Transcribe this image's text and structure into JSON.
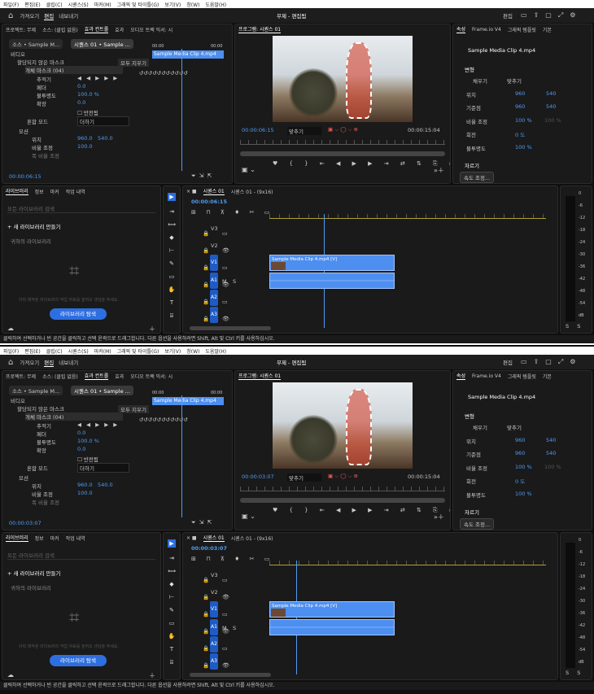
{
  "menu": [
    "파일(F)",
    "편집(E)",
    "클립(C)",
    "시퀀스(S)",
    "마커(M)",
    "그래픽 및 타이틀(G)",
    "보기(V)",
    "창(W)",
    "도움말(H)"
  ],
  "header": {
    "tabs": [
      "가져오기",
      "편집",
      "내보내기"
    ],
    "title": "무제 - 편집됨",
    "edit_label": "편집"
  },
  "source_tabs": [
    "프로젝트: 무제",
    "소스: (클립 없음)",
    "효과 컨트롤",
    "효과",
    "오디오 트랙 믹서: 시"
  ],
  "effect_controls": {
    "source_chip": "소스 • Sample M...",
    "seq_chip": "시퀀스 01 • Sample ...",
    "video_label": "비디오",
    "unassigned_mask": "할당되지 않은 마스크",
    "object_mask": "개체 마스크 (04)",
    "track_label": "추적기",
    "feather": "페더",
    "feather_val": "0.0",
    "opacity": "불투명도",
    "opacity_val": "100.0 %",
    "expand": "확장",
    "expand_val": "0.0",
    "invert": "반전됨",
    "blend": "혼합 모드",
    "blend_val": "더하기",
    "motion": "모션",
    "position": "위치",
    "pos_x": "960.0",
    "pos_y": "540.0",
    "scale": "비율 조정",
    "scale_val": "100.0",
    "scale_w": "폭 비율 조정",
    "clear_btn": "모두 지우기",
    "clip_name": "Sample Media Clip 4.mp4",
    "ruler_start": "00:00",
    "ruler_end": "00:00"
  },
  "program": {
    "title": "프로그램: 시퀀스 01",
    "fit": "맞추기",
    "total": "00:00:15:04"
  },
  "props": {
    "tabs": [
      "속성",
      "Frame.io V4",
      "그래픽 템플릿",
      "기본"
    ],
    "clip": "Sample Media Clip 4.mp4",
    "transform": "변형",
    "fill_left": "채우기",
    "fill_right": "맞추기",
    "position": "위치",
    "pos_x": "960",
    "pos_y": "540",
    "anchor": "기준점",
    "anc_x": "960",
    "anc_y": "540",
    "scale": "비율 조정",
    "scale_v": "100 %",
    "scale_v2": "100 %",
    "rotate": "회전",
    "rotate_v": "0 도",
    "opacity": "불투명도",
    "opacity_v": "100 %",
    "crop": "자르기",
    "speed_btn": "속도 조정..."
  },
  "library": {
    "tabs": [
      "라이브러리",
      "정보",
      "마커",
      "작업 내역"
    ],
    "search_placeholder": "모든 라이브러리 검색",
    "new_lib": "+ 새 라이브러리 만들기",
    "my_lib": "귀하의 라이브러리",
    "empty_msg": "아직 제작된 라이브러리 작업 자료를 높여오 생성을 주세요.",
    "explore_btn": "라이브러리 탐색"
  },
  "timeline": {
    "tabs": [
      "시퀀스 01",
      "시퀀스 01 - (9x16)"
    ],
    "tracks_v": [
      "V3",
      "V2",
      "V1"
    ],
    "tracks_a": [
      "A1",
      "A2",
      "A3"
    ],
    "clip_v": "Sample Media Clip 4.mp4 [V]",
    "db_labels": [
      "0",
      "-6",
      "-12",
      "-18",
      "-24",
      "-30",
      "-36",
      "-42",
      "-48",
      "-54",
      "dB"
    ],
    "ms": [
      "M",
      "S"
    ]
  },
  "status": "클릭하여 선택하거나 빈 공간을 클릭하고 선택 윤곽으로 드래그합니다. 다른 옵션을 사용하려면 Shift, Alt 및 Ctrl 키를 사용하십시오.",
  "instances": [
    {
      "ec_time": "00:00:06:15",
      "prog_time": "00:00:06:15",
      "tl_time": "00:00:06:15"
    },
    {
      "ec_time": "00:00:03:07",
      "prog_time": "00:00:03:07",
      "tl_time": "00:00:03:07"
    }
  ]
}
